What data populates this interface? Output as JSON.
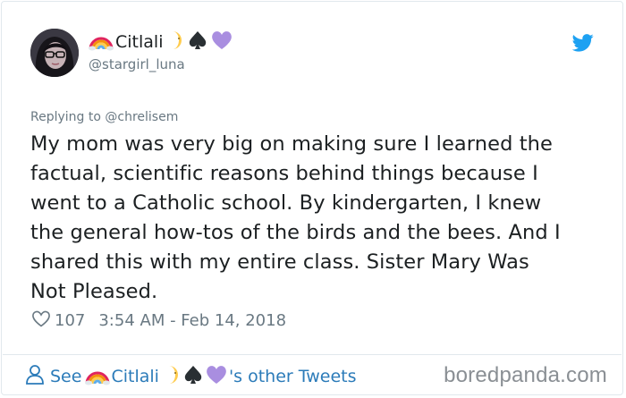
{
  "tweet": {
    "display_name": "Citlali",
    "handle": "@stargirl_luna",
    "replying_to": "Replying to @chrelisem",
    "text": "My mom was very big on making sure I learned the\nfactual, scientific reasons behind things because I\nwent to a Catholic school. By kindergarten, I knew\nthe general how-tos of the birds and the bees. And I\nshared this with my entire class. Sister Mary Was\nNot Pleased.",
    "likes": "107",
    "timestamp": "3:54 AM - Feb 14, 2018"
  },
  "footer": {
    "see_label": "See",
    "display_name": "Citlali",
    "suffix": "'s other Tweets",
    "brand": "boredpanda.com"
  },
  "colors": {
    "link": "#2b7bb9",
    "muted": "#697882",
    "twitter_blue": "#1da1f2",
    "heart_emoji": "#a98ee0"
  },
  "icons": [
    "rainbow-icon",
    "crescent-moon-icon",
    "spade-icon",
    "purple-heart-icon",
    "twitter-bird-icon",
    "heart-outline-icon",
    "person-icon"
  ]
}
